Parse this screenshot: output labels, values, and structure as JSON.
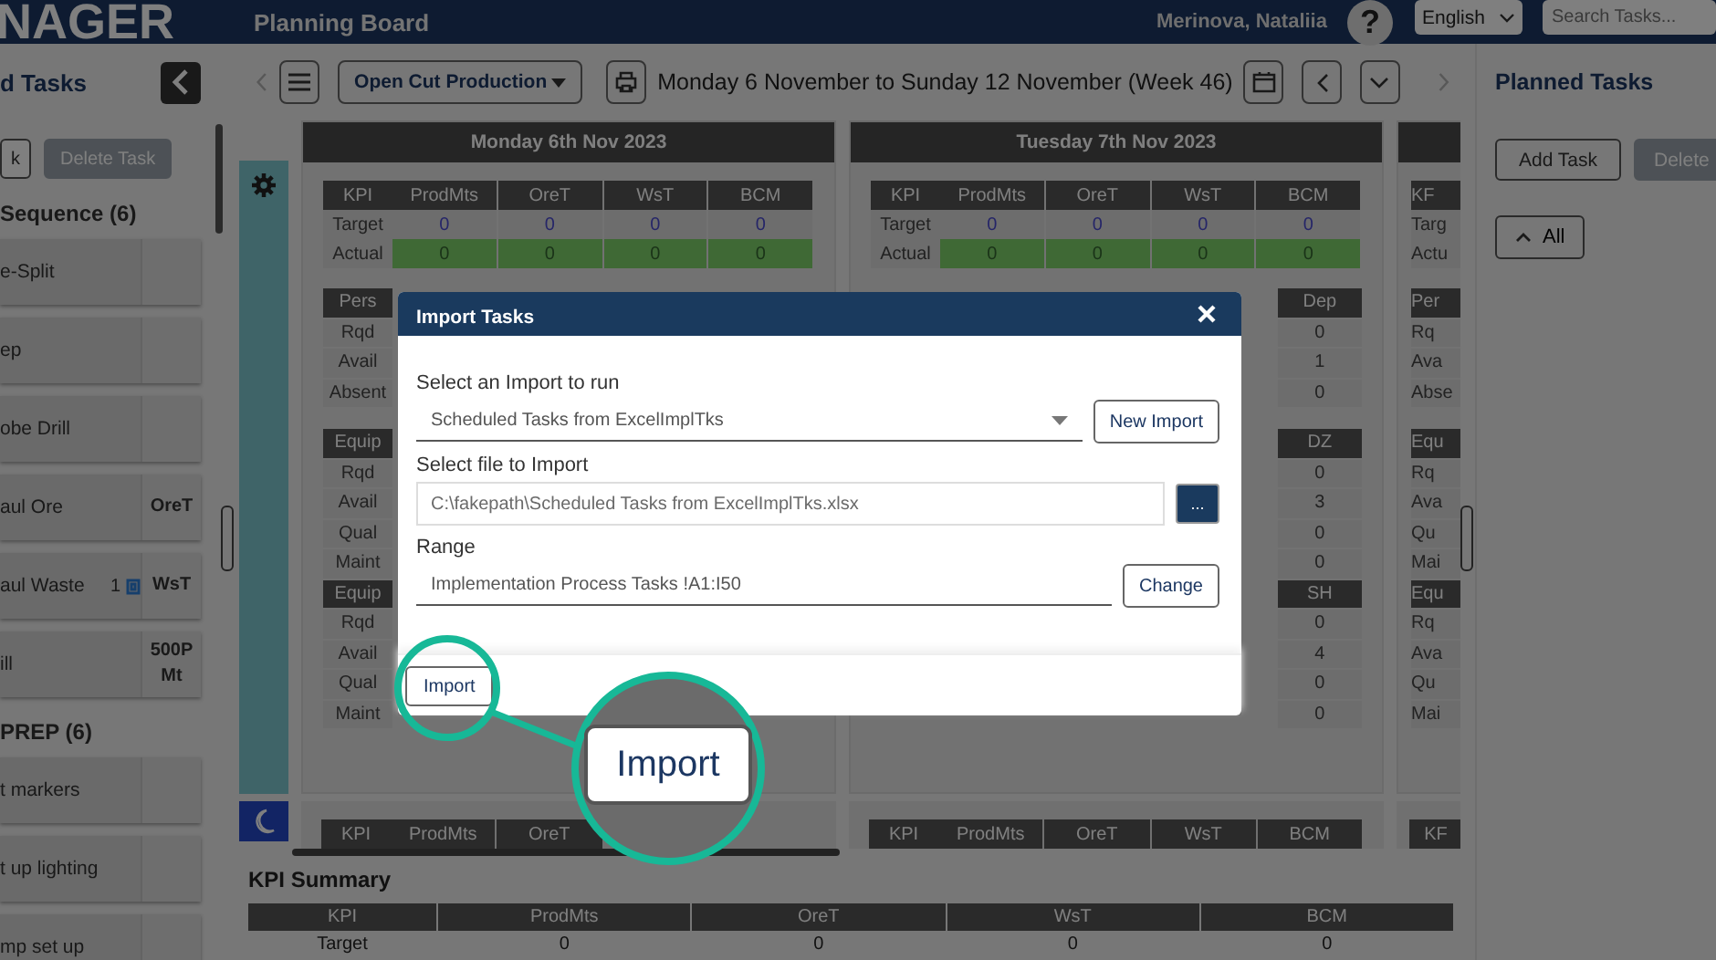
{
  "header": {
    "logo": "NAGER",
    "title": "Planning Board",
    "user": "Merinova, Nataliia",
    "help": "?",
    "language": "English",
    "search_placeholder": "Search Tasks..."
  },
  "left_panel": {
    "title": "d Tasks",
    "buttons": [
      {
        "label": "k",
        "disabled": false
      },
      {
        "label": "Delete Task",
        "disabled": true
      }
    ],
    "groups": [
      {
        "title": "Sequence (6)",
        "tasks": [
          {
            "name": "e-Split"
          },
          {
            "name": "ep"
          },
          {
            "name": "obe Drill"
          },
          {
            "name": "aul Ore",
            "badge": "OreT"
          },
          {
            "name": "aul Waste",
            "count": "1",
            "badge": "WsT"
          },
          {
            "name": "ill",
            "badge": "500P Mt"
          }
        ]
      },
      {
        "title": "PREP (6)",
        "tasks": [
          {
            "name": "t markers"
          },
          {
            "name": "t up lighting"
          },
          {
            "name": "mp set up"
          }
        ]
      }
    ]
  },
  "toolbar": {
    "board": "Open Cut Production",
    "range": "Monday 6 November to Sunday 12 November (Week 46)"
  },
  "days": [
    {
      "title": "Monday 6th Nov 2023",
      "kpi": {
        "columns": [
          "KPI",
          "ProdMts",
          "OreT",
          "WsT",
          "BCM"
        ],
        "rows": [
          {
            "label": "Target",
            "kind": "target",
            "values": [
              "0",
              "0",
              "0",
              "0"
            ]
          },
          {
            "label": "Actual",
            "kind": "actual",
            "values": [
              "0",
              "0",
              "0",
              "0"
            ]
          }
        ]
      },
      "resources": [
        {
          "header": "Pers",
          "rows": [
            "Rqd",
            "Avail",
            "Absent"
          ]
        },
        {
          "header": "Equip",
          "rows": [
            "Rqd",
            "Avail",
            "Qual",
            "Maint"
          ]
        },
        {
          "header": "Equip",
          "rows": [
            "Rqd",
            "Avail",
            "Qual",
            "Maint"
          ]
        }
      ],
      "bottom_kpi": [
        "KPI",
        "ProdMts",
        "OreT"
      ]
    },
    {
      "title": "Tuesday 7th Nov 2023",
      "kpi": {
        "columns": [
          "KPI",
          "ProdMts",
          "OreT",
          "WsT",
          "BCM"
        ],
        "rows": [
          {
            "label": "Target",
            "kind": "target",
            "values": [
              "0",
              "0",
              "0",
              "0"
            ]
          },
          {
            "label": "Actual",
            "kind": "actual",
            "values": [
              "0",
              "0",
              "0",
              "0"
            ]
          }
        ]
      },
      "resources": [
        {
          "header": "Dep",
          "values": [
            "0",
            "1",
            "0"
          ]
        },
        {
          "header": "DZ",
          "values": [
            "0",
            "3",
            "0",
            "0"
          ]
        },
        {
          "header": "SH",
          "values": [
            "0",
            "4",
            "0",
            "0"
          ]
        }
      ],
      "bottom_kpi": [
        "KPI",
        "ProdMts",
        "OreT",
        "WsT",
        "BCM"
      ]
    },
    {
      "kpi": {
        "columns": [
          "KF"
        ],
        "rows": [
          {
            "label": "Targ"
          },
          {
            "label": "Actu"
          }
        ]
      },
      "resources": [
        {
          "header": "Per",
          "rows": [
            "Rq",
            "Ava",
            "Abse"
          ]
        },
        {
          "header": "Equ",
          "rows": [
            "Rq",
            "Ava",
            "Qu",
            "Mai"
          ]
        },
        {
          "header": "Equ",
          "rows": [
            "Rq",
            "Ava",
            "Qu",
            "Mai"
          ]
        }
      ],
      "bottom_kpi": [
        "KF"
      ]
    }
  ],
  "kpi_summary": {
    "title": "KPI Summary",
    "columns": [
      "KPI",
      "ProdMts",
      "OreT",
      "WsT",
      "BCM"
    ],
    "rows": [
      {
        "label": "Target",
        "values": [
          "0",
          "0",
          "0",
          "0"
        ]
      }
    ]
  },
  "right_panel": {
    "title": "Planned Tasks",
    "buttons": [
      {
        "label": "Add Task",
        "disabled": false
      },
      {
        "label": "Delete",
        "disabled": true
      }
    ],
    "filter": "All"
  },
  "import_dialog": {
    "title": "Import Tasks",
    "fields": [
      {
        "kind": "select",
        "label": "Select an Import to run",
        "value": "Scheduled Tasks from ExcelImplTks",
        "button": "New Import"
      },
      {
        "kind": "file",
        "label": "Select file to Import",
        "value": "C:\\fakepath\\Scheduled Tasks from ExcelImplTks.xlsx",
        "button": "..."
      },
      {
        "kind": "range",
        "label": "Range",
        "value": "Implementation Process Tasks !A1:I50",
        "button": "Change"
      }
    ],
    "primary_button": "Import"
  },
  "callout": {
    "label": "Import"
  }
}
